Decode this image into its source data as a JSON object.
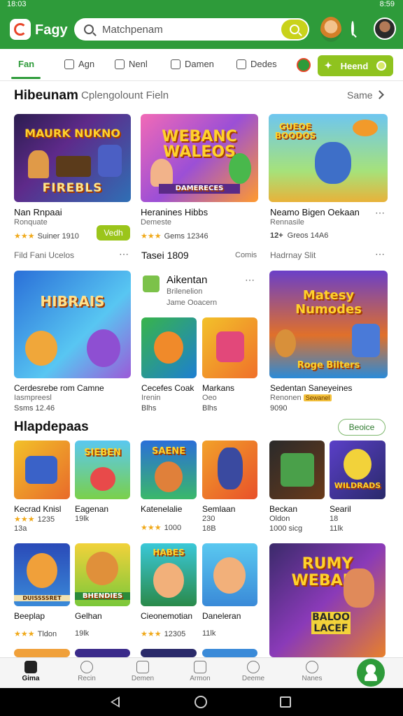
{
  "status": {
    "time": "18:03",
    "right": "8:59"
  },
  "header": {
    "app_name": "Fagy",
    "search_placeholder": "Matchpenam"
  },
  "tabs": [
    {
      "label": "Fan",
      "active": true
    },
    {
      "label": "Agn"
    },
    {
      "label": "Nenl"
    },
    {
      "label": "Damen"
    },
    {
      "label": "Dedes"
    }
  ],
  "hot_button": "Heend",
  "section1": {
    "title": "Hibeunam",
    "subtitle": "Cplengolount Fieln",
    "see_all": "Same",
    "cards": [
      {
        "art": "FIREBLS",
        "art_top": "MAURK NUKNO",
        "name": "Nan Rnpaai",
        "dev": "Ronquate",
        "meta": "Suiner 1910",
        "stars": "★★★",
        "button": "Vedh"
      },
      {
        "art": "WEBANC WALEOS",
        "art_top": "",
        "name": "Heranines Hibbs",
        "dev": "Demeste",
        "meta": "Gems 12346",
        "stars": "★★★",
        "strip": "DAMERECES"
      },
      {
        "art": "",
        "art_top": "GUEOE BOODOS",
        "name": "Neamo Bigen Oekaan",
        "dev": "Rennasile",
        "meta": "Greos 14A6",
        "stars": "12+"
      }
    ]
  },
  "row2": {
    "left_label": "Fild Fani Ucelos",
    "mid_label": "Tasei 1809",
    "mid_right": "Comis",
    "right_label": "Hadrnay Slit",
    "cards": [
      {
        "art": "HIBRAIS",
        "name": "Cerdesrebe rom Camne",
        "dev": "Iasmpreesl",
        "meta": "Ssms 12.46"
      },
      {
        "title": "Aikentan",
        "sub1": "Brilenelion",
        "sub2": "Jame Ooacern"
      },
      {
        "name": "Cecefes Coak",
        "dev": "Irenin",
        "meta": "Blhs"
      },
      {
        "name": "Markans",
        "dev": "Oeo",
        "meta": "Blhs"
      },
      {
        "art": "Matesy Numodes",
        "art_bottom": "Roge Bilters",
        "name": "Sedentan Saneyeines",
        "dev": "Renonen",
        "badge": "Sewanel",
        "meta": "9090"
      }
    ]
  },
  "section2": {
    "title": "Hlapdepaas",
    "button": "Beoice",
    "row1": [
      {
        "art": "",
        "name": "Kecrad Knisl",
        "meta": "1235",
        "meta2": "13a",
        "stars": "★★★"
      },
      {
        "art": "SIEBEN",
        "name": "Eagenan",
        "meta": "19lk",
        "meta2": ""
      },
      {
        "art": "SAENE",
        "name": "Katenelalie",
        "meta": "1000",
        "stars": "★★★"
      },
      {
        "art": "",
        "name": "Semlaan",
        "meta": "230",
        "meta2": "18B"
      },
      {
        "art": "",
        "name": "Beckan",
        "meta": "Oldon",
        "meta2": "1000 sicg"
      },
      {
        "art": "WILDRADS",
        "name": "Searil",
        "meta": "18",
        "meta2": "11lk"
      }
    ],
    "row2": [
      {
        "art": "DUISSSSRET",
        "name": "Beeplap",
        "meta": "Tldon",
        "stars": "★★★"
      },
      {
        "art": "BHENDIES",
        "name": "Gelhan",
        "meta": "19lk"
      },
      {
        "art": "HABES",
        "name": "Cieonemotian",
        "meta": "12305",
        "stars": "★★★"
      },
      {
        "art": "",
        "name": "Daneleran",
        "meta": "11lk"
      },
      {
        "art": "RUMY WEBALS",
        "art_bottom": "BALOO LACEF",
        "name": ""
      }
    ]
  },
  "bottom_nav": [
    {
      "label": "Gima",
      "active": true
    },
    {
      "label": "Recin"
    },
    {
      "label": "Demen"
    },
    {
      "label": "Armon"
    },
    {
      "label": "Deeme"
    },
    {
      "label": "Nanes"
    }
  ],
  "colors": {
    "brand": "#2e9b3a",
    "accent": "#9bc51b",
    "star": "#f0a91a"
  }
}
